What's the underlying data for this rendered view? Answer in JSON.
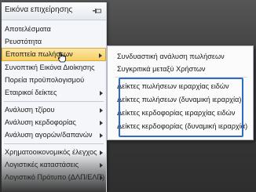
{
  "sidebar": {
    "header_title": "Εικόνα επιχείρησης",
    "items": [
      {
        "label": "Αποτελέσματα"
      },
      {
        "label": "Ρευστότητα"
      },
      {
        "label": "Εποπτεία πωλήσεων"
      },
      {
        "label": "Συνοπτική Εικόνα Διοίκησης"
      },
      {
        "label": "Πορεία προϋπολογισμού"
      },
      {
        "label": "Εταιρικοί δείκτες"
      },
      {
        "label": "Ανάλυση τζίρου"
      },
      {
        "label": "Ανάλυση κερδοφορίας"
      },
      {
        "label": "Ανάλυση αγορών/δαπανών"
      },
      {
        "label": "Χρηματοοικονομικός έλεγχος"
      },
      {
        "label": "Λογιστικές καταστάσεις"
      },
      {
        "label": "Λογιστικό Πρότυπο (ΔΛΠ/ΕΛΠ)"
      }
    ]
  },
  "submenu": {
    "items": [
      {
        "label": "Συνδυαστική ανάλυση πωλήσεων"
      },
      {
        "label": "Συγκριτικά μεταξύ Χρήστων"
      },
      {
        "label": "Δείκτες πωλήσεων ιεραρχίας ειδών"
      },
      {
        "label": "Δείκτες πωλήσεων (δυναμική ιεραρχία)"
      },
      {
        "label": "Δείκτες κερδοφορίας ιεραρχίας ειδών"
      },
      {
        "label": "Δείκτες κερδοφορίας (δυναμική ιεραρχία)"
      }
    ]
  },
  "colors": {
    "highlight_border": "#2d6bc7",
    "active_item": "#f6cf62"
  },
  "icons": {
    "pin": "pin-icon",
    "cursor": "hand-cursor-icon",
    "arrow": "chevron-right-icon"
  }
}
